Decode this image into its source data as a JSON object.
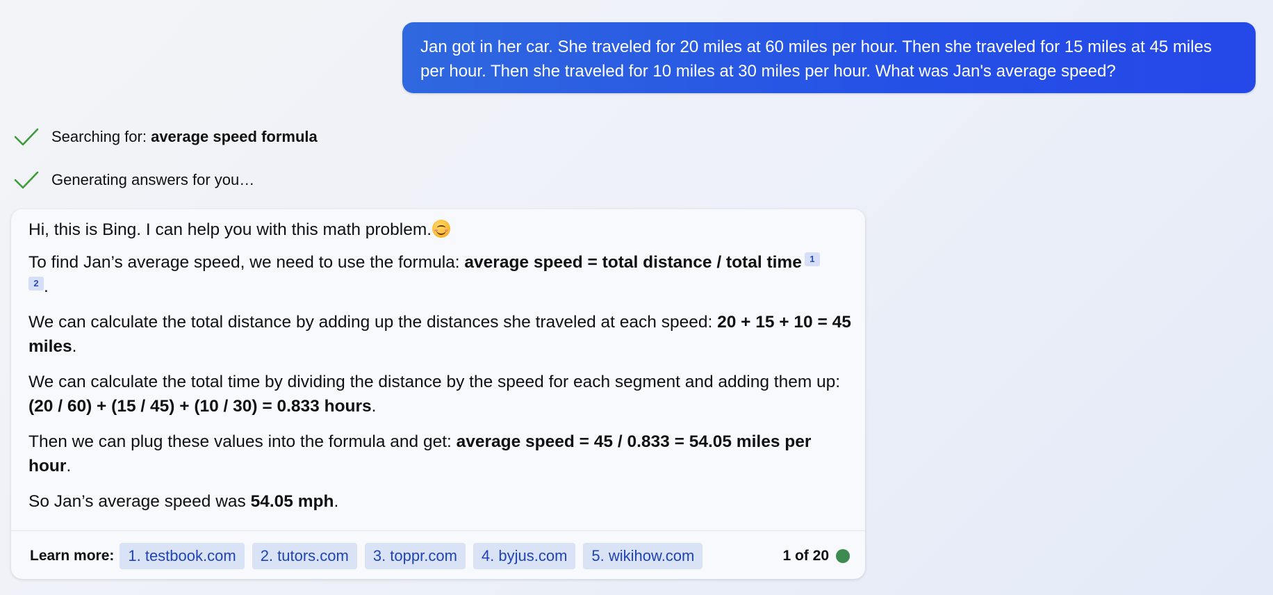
{
  "user_message": {
    "text": "Jan got in her car. She traveled for 20 miles at 60 miles per hour. Then she traveled for 15 miles at 45 miles per hour. Then she traveled for 10 miles at 30 miles per hour. What was Jan's average speed?"
  },
  "status": {
    "searching_prefix": "Searching for: ",
    "searching_query": "average speed formula",
    "generating": "Generating answers for you…"
  },
  "answer": {
    "greeting": "Hi, this is Bing. I can help you with this math problem.",
    "greeting_emoji": "smiling-face-icon",
    "p1_text": "To find Jan’s average speed, we need to use the formula: ",
    "p1_bold": "average speed = total distance / total time",
    "p1_cite1": "1",
    "p1_cite2": "2",
    "p1_end": ".",
    "p2_text": "We can calculate the total distance by adding up the distances she traveled at each speed: ",
    "p2_bold": "20 + 15 + 10 = 45 miles",
    "p2_end": ".",
    "p3_text": "We can calculate the total time by dividing the distance by the speed for each segment and adding them up: ",
    "p3_bold": "(20 / 60) + (15 / 45) + (10 / 30) = 0.833 hours",
    "p3_end": ".",
    "p4_text": "Then we can plug these values into the formula and get: ",
    "p4_bold": "average speed = 45 / 0.833 = 54.05 miles per hour",
    "p4_end": ".",
    "p5_text": "So Jan’s average speed was ",
    "p5_bold": "54.05 mph",
    "p5_end": "."
  },
  "learn_more": {
    "label": "Learn more:",
    "sources": [
      "1. testbook.com",
      "2. tutors.com",
      "3. toppr.com",
      "4. byjus.com",
      "5. wikihow.com"
    ]
  },
  "turn_counter": "1 of 20",
  "colors": {
    "user_bubble": "#2550e6",
    "check": "#3e9b3a",
    "source_chip_bg": "#dae2f6",
    "source_chip_text": "#1f45b5",
    "status_dot": "#3e8b4f"
  }
}
